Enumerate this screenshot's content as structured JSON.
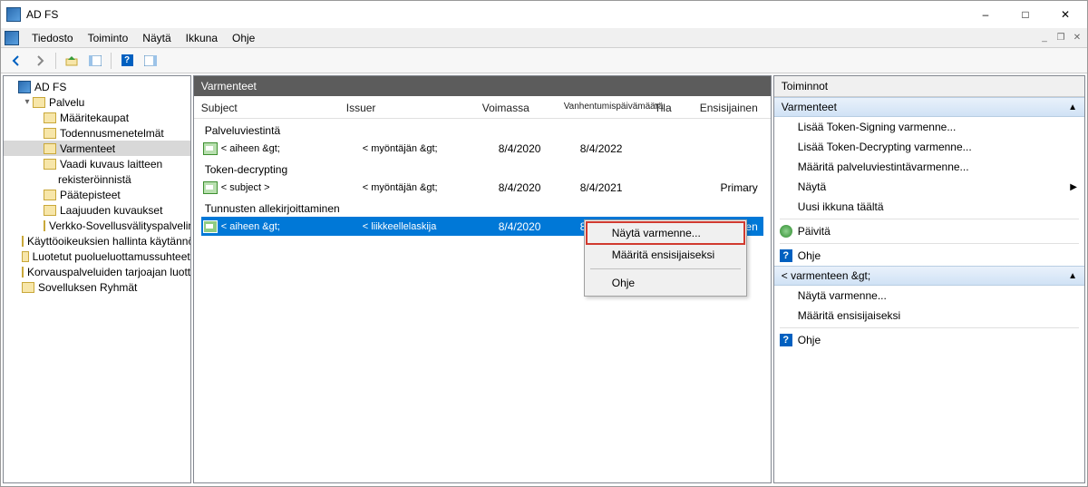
{
  "title": "AD FS",
  "menu": {
    "file": "Tiedosto",
    "action": "Toiminto",
    "view": "Näytä",
    "window": "Ikkuna",
    "help": "Ohje"
  },
  "tree": {
    "root": "AD FS",
    "service": "Palvelu",
    "items": [
      "Määritekaupat",
      "Todennusmenetelmät",
      "Varmenteet",
      "Vaadi kuvaus laitteen",
      "rekisteröinnistä",
      "Päätepisteet",
      "Laajuuden kuvaukset",
      "Verkko-Sovellusvälityspalvelin"
    ],
    "bottom": [
      "Käyttöoikeuksien hallinta käytännöt",
      "Luotetut puolueluottamussuhteet",
      "Korvauspalveluiden tarjoajan luottamus",
      "Sovelluksen Ryhmät"
    ]
  },
  "center": {
    "header": "Varmenteet",
    "cols": {
      "subject": "Subject",
      "issuer": "Issuer",
      "eff": "Voimassa",
      "exp": "Vanhentumispäivämäärä",
      "status": "Tila",
      "primary": "Ensisijainen"
    },
    "groups": [
      {
        "title": "Palveluviestintä",
        "rows": [
          {
            "subject": "< aiheen &gt;",
            "issuer": "< myöntäjän &gt;",
            "eff": "8/4/2020",
            "exp": "8/4/2022",
            "primary": ""
          }
        ]
      },
      {
        "title": "Token-decrypting",
        "rows": [
          {
            "subject": "< subject >",
            "issuer": "< myöntäjän &gt;",
            "eff": "8/4/2020",
            "exp": "8/4/2021",
            "primary": "Primary"
          }
        ]
      },
      {
        "title": "Tunnusten allekirjoittaminen",
        "rows": [
          {
            "subject": "< aiheen &gt;",
            "issuer": "< liikkeellelaskija",
            "eff": "8/4/2020",
            "exp": "8/4/2021",
            "primary": "Ensisijainen",
            "selected": true
          }
        ]
      }
    ]
  },
  "context": {
    "view_cert": "Näytä varmenne...",
    "set_primary": "Määritä ensisijaiseksi",
    "help": "Ohje"
  },
  "actions": {
    "header": "Toiminnot",
    "section1": "Varmenteet",
    "add_signing": "Lisää Token-Signing varmenne...",
    "add_decrypt": "Lisää Token-Decrypting varmenne...",
    "set_service": "Määritä palveluviestintävarmenne...",
    "view": "Näytä",
    "new_window": "Uusi ikkuna täältä",
    "refresh": "Päivitä",
    "help": "Ohje",
    "section2": "< varmenteen &gt;",
    "view_cert": "Näytä varmenne...",
    "set_primary": "Määritä ensisijaiseksi",
    "help2": "Ohje"
  }
}
